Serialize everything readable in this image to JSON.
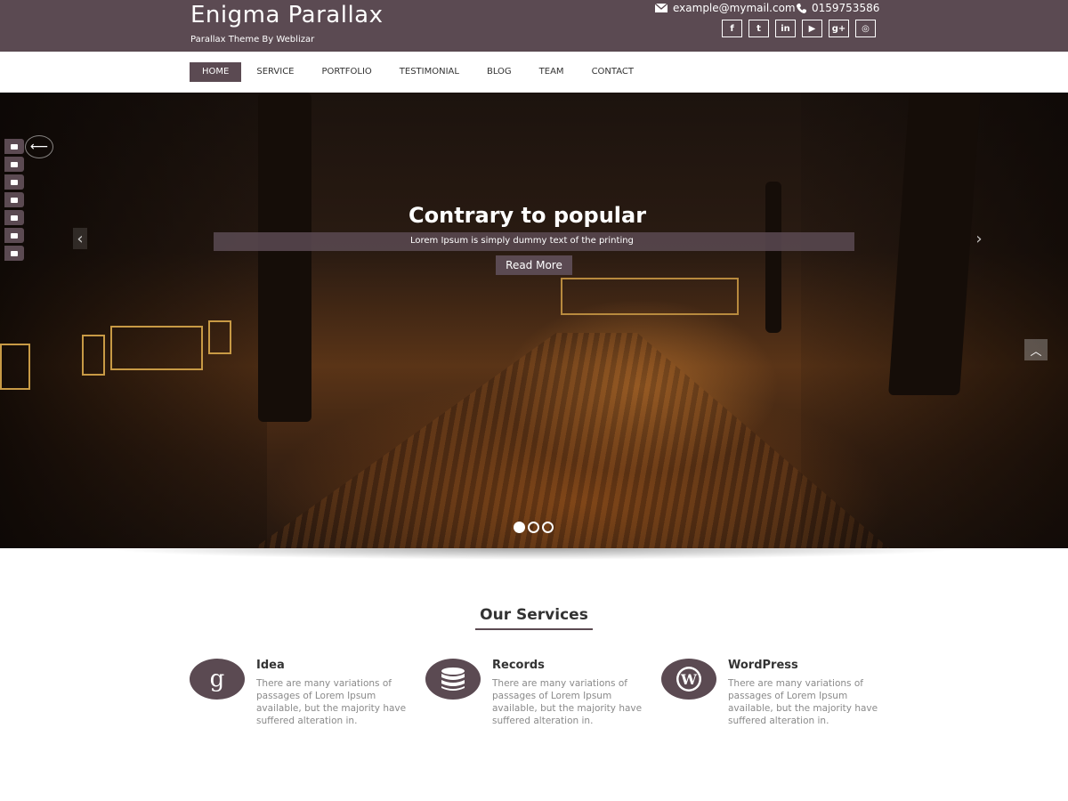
{
  "header": {
    "site_title": "Enigma Parallax",
    "tagline": "Parallax Theme By Weblizar",
    "email": "example@mymail.com",
    "phone": "0159753586",
    "social": [
      {
        "icon": "facebook-icon",
        "glyph": "f"
      },
      {
        "icon": "twitter-icon",
        "glyph": "t"
      },
      {
        "icon": "linkedin-icon",
        "glyph": "in"
      },
      {
        "icon": "youtube-icon",
        "glyph": "▶"
      },
      {
        "icon": "google-plus-icon",
        "glyph": "g+"
      },
      {
        "icon": "instagram-icon",
        "glyph": "◎"
      }
    ]
  },
  "nav": {
    "items": [
      "HOME",
      "SERVICE",
      "PORTFOLIO",
      "TESTIMONIAL",
      "BLOG",
      "TEAM",
      "CONTACT"
    ],
    "active": "HOME"
  },
  "hero": {
    "title": "Contrary to popular",
    "subtitle": "Lorem Ipsum is simply dummy text of the printing",
    "button": "Read More",
    "slides": 3,
    "active_slide": 1
  },
  "services": {
    "heading": "Our Services",
    "items": [
      {
        "title": "Idea",
        "icon": "google-g-icon",
        "text": "There are many variations of passages of Lorem Ipsum available, but the majority have suffered alteration in."
      },
      {
        "title": "Records",
        "icon": "database-icon",
        "text": "There are many variations of passages of Lorem Ipsum available, but the majority have suffered alteration in."
      },
      {
        "title": "WordPress",
        "icon": "wordpress-icon",
        "text": "There are many variations of passages of Lorem Ipsum available, but the majority have suffered alteration in."
      }
    ]
  },
  "colors": {
    "primary": "#5b4a52",
    "text": "#333333",
    "muted": "#8a8a8a"
  }
}
